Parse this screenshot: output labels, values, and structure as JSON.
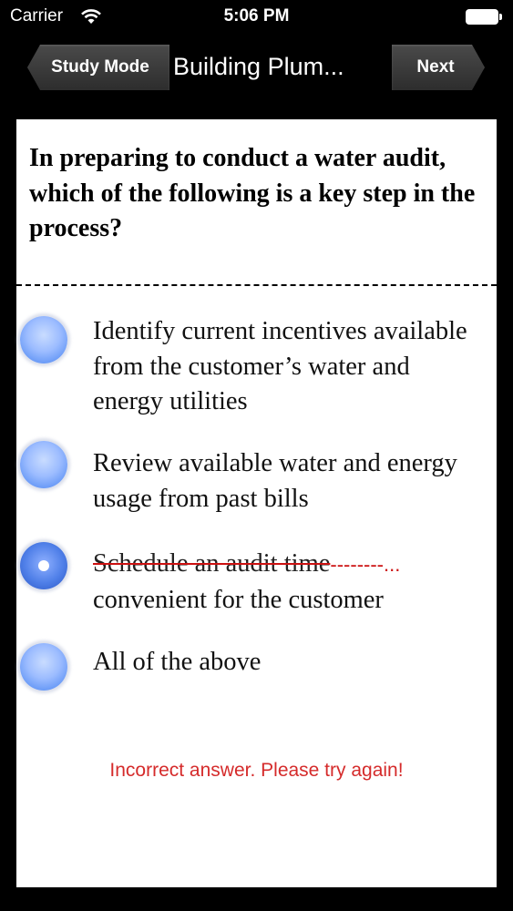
{
  "status_bar": {
    "carrier": "Carrier",
    "time": "5:06 PM"
  },
  "nav": {
    "back_label": "Study Mode",
    "title": "Building Plum...",
    "next_label": "Next"
  },
  "question": {
    "text": "In preparing to conduct a water audit, which of the following is a key step in the process?",
    "options": [
      {
        "text": "Identify current incentives available from the customer’s water and energy utilities",
        "selected": false
      },
      {
        "text": "Review available water and energy usage from past bills",
        "selected": false
      },
      {
        "line1": "Schedule an audit time",
        "line1_suffix": "--------...",
        "line2": "convenient for the customer",
        "selected": true,
        "marked_incorrect": true
      },
      {
        "text": "All of the above",
        "selected": false
      }
    ]
  },
  "feedback": "Incorrect answer. Please try again!",
  "colors": {
    "background": "#000000",
    "card": "#ffffff",
    "error": "#d52b2b",
    "radio_blue": "#6c9cf7"
  },
  "icons": [
    "wifi-icon",
    "battery-icon"
  ]
}
